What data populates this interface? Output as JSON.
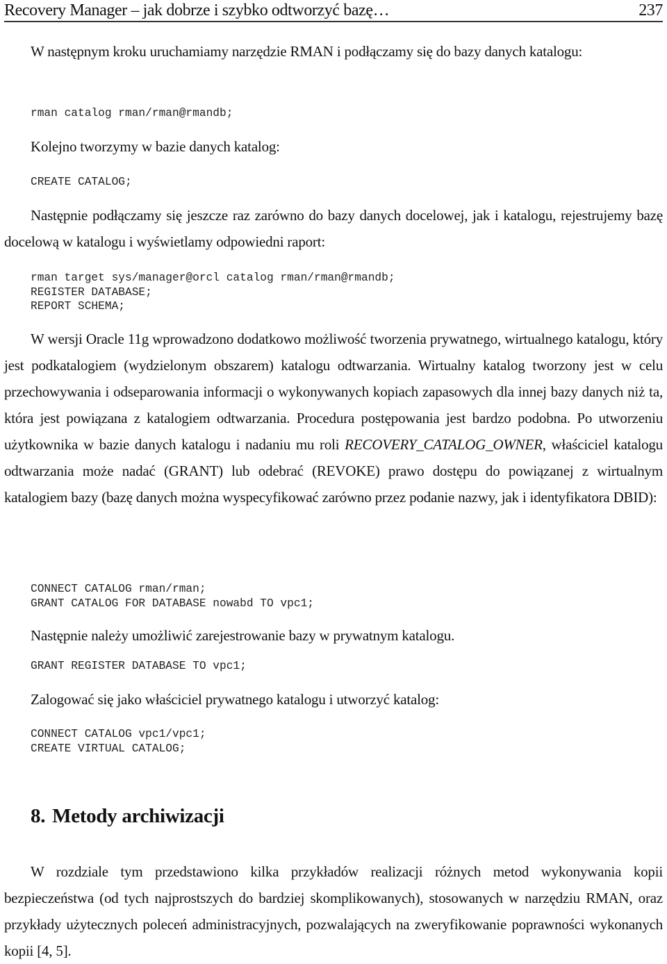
{
  "header": {
    "title": "Recovery Manager – jak dobrze i szybko odtworzyć bazę…",
    "page_number": "237"
  },
  "content": {
    "p1": "W następnym kroku uruchamiamy narzędzie RMAN i podłączamy się do bazy danych katalogu:",
    "code1": [
      "rman catalog rman/rman@rmandb;"
    ],
    "p2": "Kolejno tworzymy w bazie danych katalog:",
    "code2": [
      "CREATE CATALOG;"
    ],
    "p3": "Następnie podłączamy się jeszcze raz zarówno do bazy danych docelowej, jak i katalogu, rejestrujemy bazę docelową w katalogu i wyświetlamy odpowiedni raport:",
    "code3": [
      "rman target sys/manager@orcl catalog rman/rman@rmandb;",
      "REGISTER DATABASE;",
      "REPORT SCHEMA;"
    ],
    "p4_before_role": "W wersji Oracle 11g wprowadzono dodatkowo możliwość tworzenia prywatnego, wirtualnego katalogu, który jest podkatalogiem (wydzielonym obszarem) katalogu odtwarzania. Wirtualny katalog tworzony jest w celu przechowywania i odseparowania informacji o wykonywanych kopiach zapasowych dla innej bazy danych niż ta, która jest powiązana z katalogiem odtwarzania. Procedura postępowania jest bardzo podobna. Po utworzeniu użytkownika w bazie danych katalogu i nadaniu mu roli ",
    "p4_role": "RECOVERY_CATALOG_OWNER",
    "p4_after_role": ", właściciel katalogu odtwarzania może nadać (GRANT) lub odebrać (REVOKE) prawo dostępu do powiązanej z wirtualnym katalogiem bazy (bazę danych można wyspecyfikować zarówno przez podanie nazwy, jak i identyfikatora DBID):",
    "code4": [
      "CONNECT CATALOG rman/rman;",
      "GRANT CATALOG FOR DATABASE nowabd TO vpc1;"
    ],
    "p5": "Następnie należy umożliwić zarejestrowanie bazy w prywatnym katalogu.",
    "code5": [
      "GRANT REGISTER DATABASE TO vpc1;"
    ],
    "p6": "Zalogować się jako właściciel prywatnego katalogu i utworzyć katalog:",
    "code6": [
      "CONNECT CATALOG vpc1/vpc1;",
      "CREATE VIRTUAL CATALOG;"
    ],
    "section": {
      "number": "8.",
      "title": "Metody archiwizacji"
    },
    "p7": "W rozdziale tym przedstawiono kilka przykładów realizacji różnych metod wykonywania kopii bezpieczeństwa (od tych najprostszych do bardziej skomplikowanych), stosowanych w narzędziu RMAN, oraz przykłady użytecznych poleceń administracyjnych, pozwalających na zweryfikowanie poprawności wykonanych kopii [4, 5]."
  }
}
